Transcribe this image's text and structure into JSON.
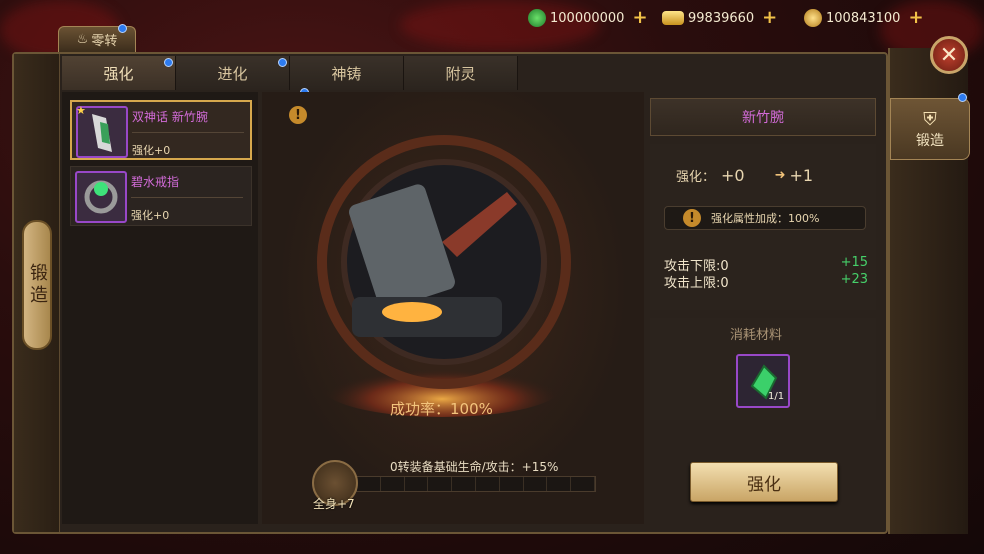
{
  "currencies": [
    {
      "icon": "jade-icon",
      "value": "100000000"
    },
    {
      "icon": "gold-ingot-icon",
      "value": "99839660"
    },
    {
      "icon": "coin-icon",
      "value": "100843100"
    }
  ],
  "zero_turn_tab": "零转",
  "tabs": [
    {
      "label": "强化",
      "active": true,
      "has_dot": true
    },
    {
      "label": "进化",
      "active": false,
      "has_dot": true
    },
    {
      "label": "神铸",
      "active": false,
      "has_dot": false
    },
    {
      "label": "附灵",
      "active": false,
      "has_dot": false
    }
  ],
  "left_rail_label": "锻造",
  "side_tab_label": "锻造",
  "items": [
    {
      "name": "双神话 新竹腕",
      "level": "强化+0",
      "selected": true,
      "icon": "bracer-icon"
    },
    {
      "name": "碧水戒指",
      "level": "强化+0",
      "selected": false,
      "icon": "ring-icon"
    }
  ],
  "center": {
    "success_rate": "成功率：100%",
    "bonus_text": "0转装备基础生命/攻击：+15%",
    "badge_label": "全身+7"
  },
  "right_panel": {
    "title": "新竹腕",
    "level_label": "强化：",
    "level_current": "+0",
    "level_next": "+1",
    "attr_bonus": "强化属性加成：100%",
    "stats": [
      {
        "label": "攻击下限:0",
        "delta": "+15"
      },
      {
        "label": "攻击上限:0",
        "delta": "+23"
      }
    ],
    "materials_title": "消耗材料",
    "material_count": "1/1",
    "material_icon": "green-gem-icon",
    "upgrade_button": "强化"
  },
  "colors": {
    "purple_quality": "#d26bd8",
    "stat_green": "#46d06a",
    "accent_gold": "#d6a84d"
  }
}
